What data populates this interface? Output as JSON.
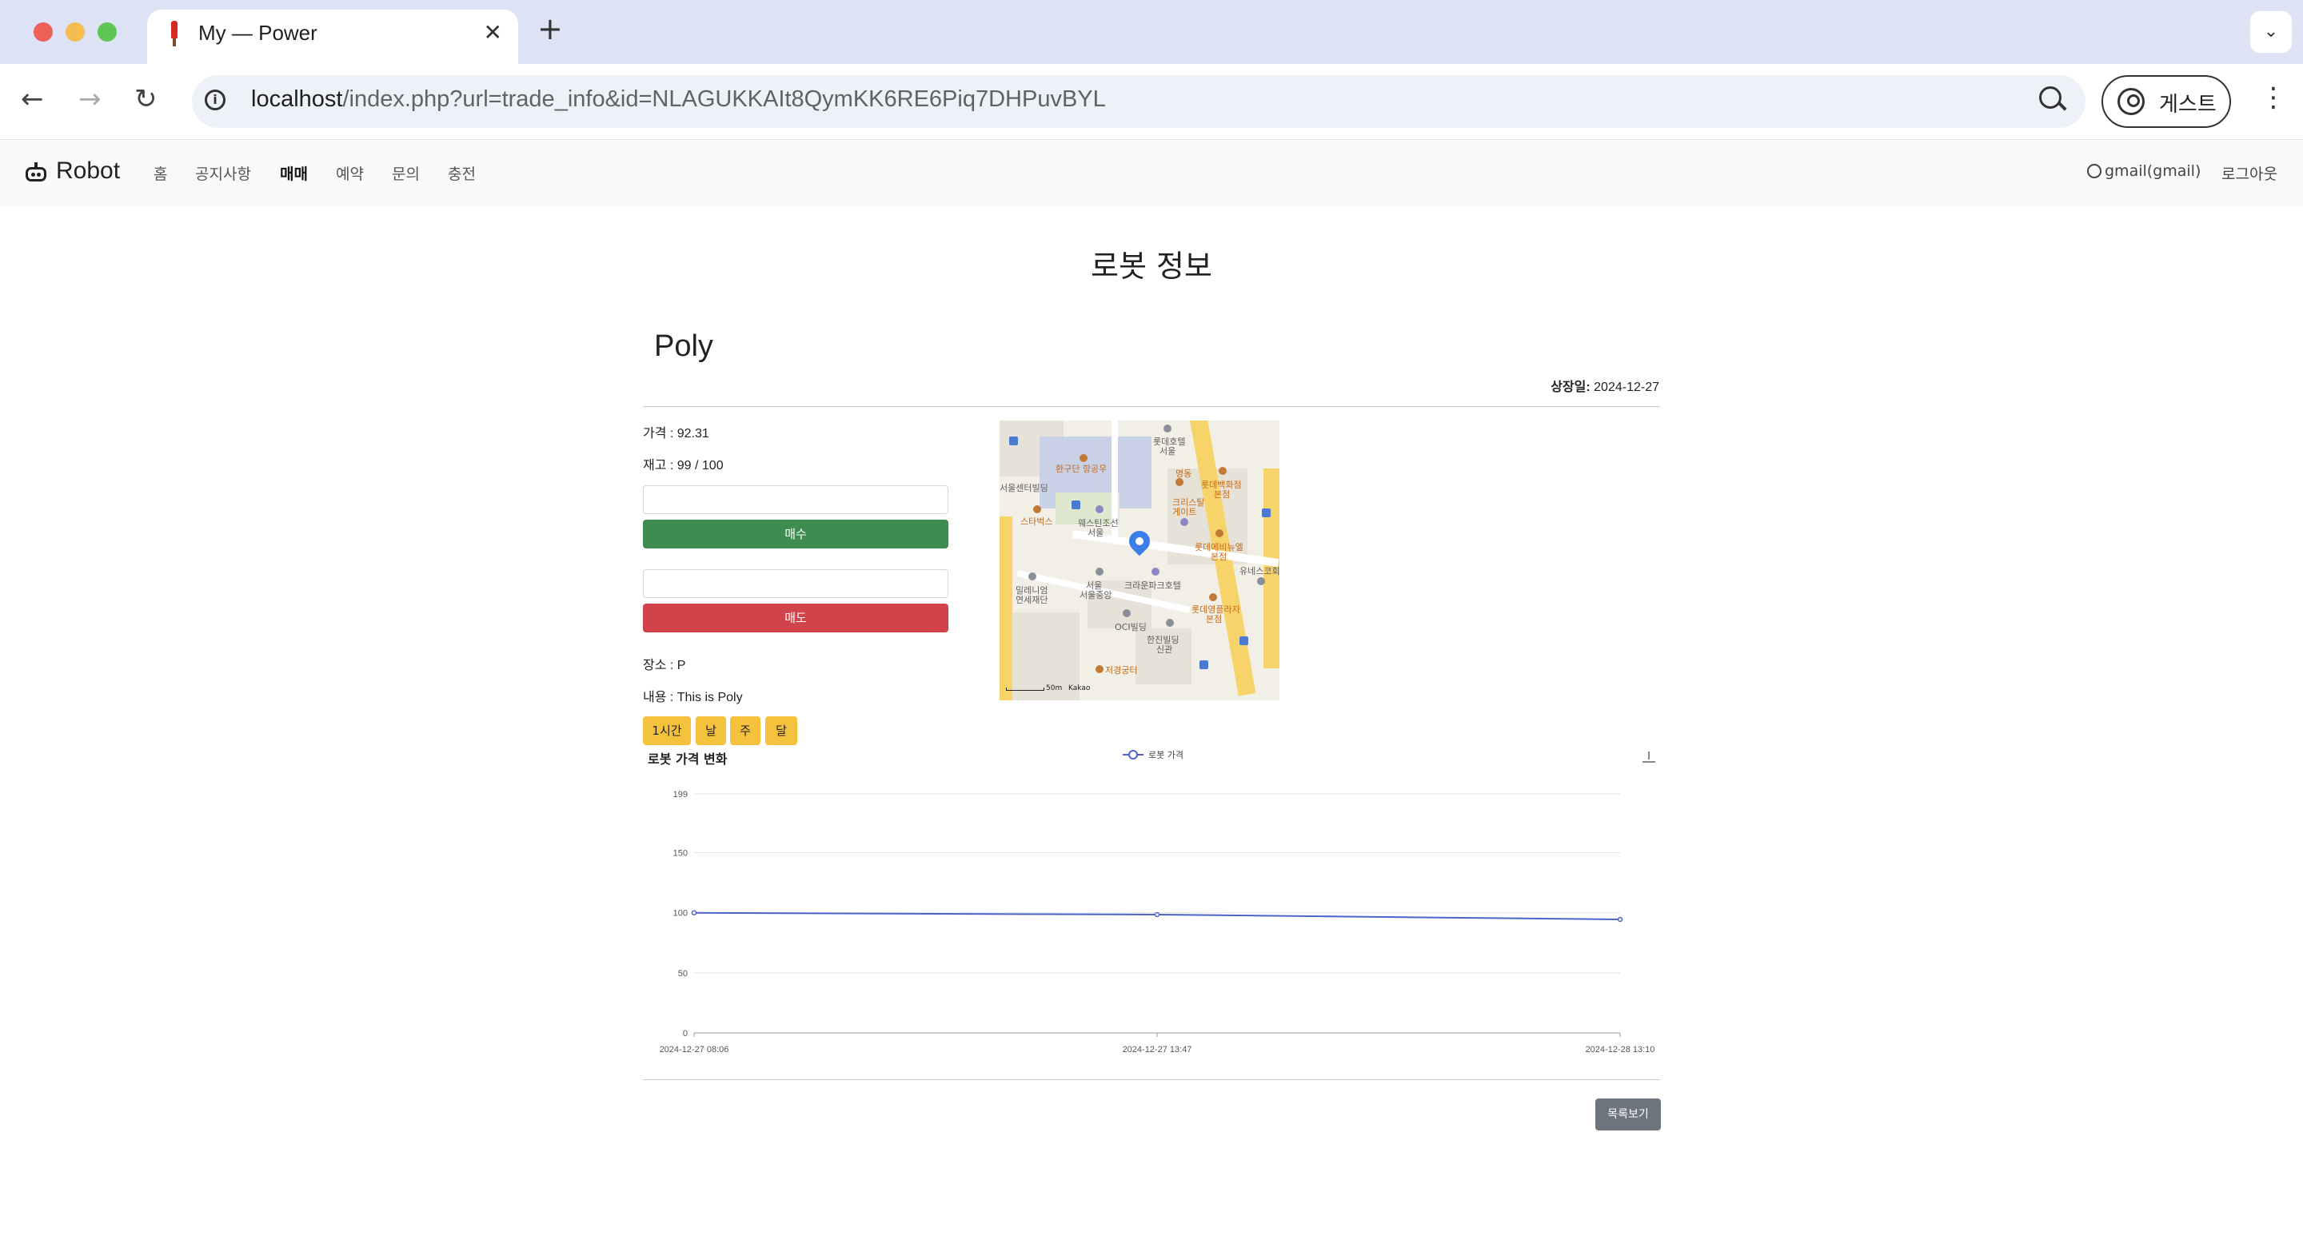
{
  "browser": {
    "tab_title": "My — Power",
    "tab_close": "✕",
    "new_tab": "+",
    "url_host": "localhost",
    "url_path": "/index.php?url=trade_info&id=NLAGUKKAIt8QymKK6RE6Piq7DHPuvBYL",
    "profile_label": "게스트",
    "tab_menu": "⌄",
    "menu": "⋮"
  },
  "site": {
    "brand": "Robot",
    "nav": [
      "홈",
      "공지사항",
      "매매",
      "예약",
      "문의",
      "충전"
    ],
    "active_nav": "매매",
    "user": "gmail(gmail)",
    "logout": "로그아웃"
  },
  "page": {
    "title": "로봇 정보",
    "robot_name": "Poly",
    "listed_label": "상장일:",
    "listed_date": "2024-12-27",
    "price_line": "가격 : 92.31",
    "stock_line": "재고 : 99 / 100",
    "buy_label": "매수",
    "sell_label": "매도",
    "location_line": "장소 : P",
    "content_line": "내용 : This is Poly",
    "ranges": [
      "1시간",
      "날",
      "주",
      "달"
    ],
    "list_button": "목록보기"
  },
  "map": {
    "labels": [
      "롯데호텔",
      "서울",
      "환구단 항공우",
      "서울센터빌딩",
      "명동",
      "롯데백화점",
      "본점",
      "크리스탈",
      "게이트",
      "스타벅스",
      "웨스틴조선",
      "서울",
      "롯데에비뉴엘",
      "본점",
      "유네스코회관",
      "서울",
      "크라운파크호텔",
      "밀레니엄",
      "연세재단",
      "서울중앙",
      "롯데영플라자",
      "본점",
      "OCI빌딩",
      "한진빌딩",
      "신관",
      "저경궁터",
      "Kakao",
      "50m"
    ]
  },
  "colors": {
    "buy": "#3e8c4f",
    "sell": "#d2424b",
    "range_button": "#f4c23c",
    "series": "#4a63c8",
    "list_button": "#6c757d"
  },
  "chart_data": {
    "type": "line",
    "title": "로봇 가격 변화",
    "legend_position": "top-center",
    "x": [
      "2024-12-27 08:06",
      "2024-12-27 13:47",
      "2024-12-28 13:10"
    ],
    "series": [
      {
        "name": "로봇 가격",
        "values": [
          100,
          98.5,
          94.5
        ]
      }
    ],
    "ylim": [
      0,
      199
    ],
    "yticks": [
      0,
      50,
      100,
      150,
      199
    ],
    "grid": true
  }
}
